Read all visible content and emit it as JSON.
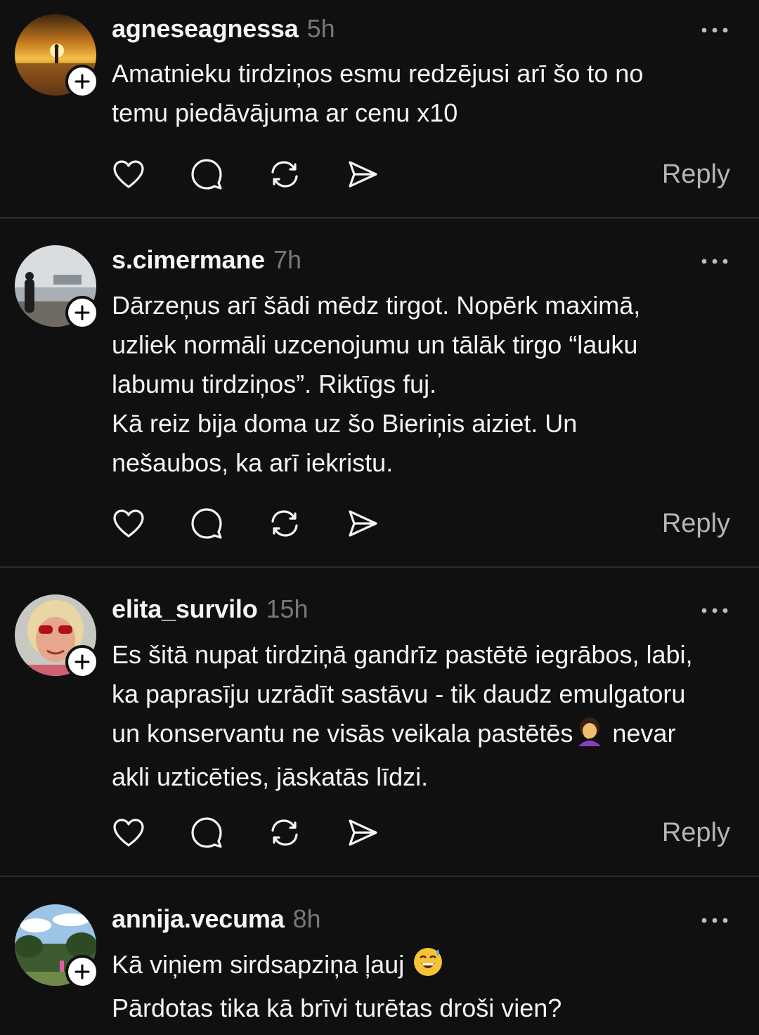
{
  "posts": [
    {
      "username": "agneseagnessa",
      "time": "5h",
      "lines": [
        "Amatnieku tirdziņos esmu redzējusi arī šo to no",
        "temu piedāvājuma ar cenu x10"
      ],
      "reply_label": "Reply"
    },
    {
      "username": "s.cimermane",
      "time": "7h",
      "lines": [
        "Dārzeņus arī šādi mēdz tirgot. Nopērk maximā,",
        "uzliek normāli uzcenojumu un tālāk tirgo “lauku",
        "labumu tirdziņos”. Riktīgs fuj.",
        "Kā reiz bija doma uz šo Bieriņis aiziet. Un",
        "nešaubos, ka arī iekristu."
      ],
      "reply_label": "Reply"
    },
    {
      "username": "elita_survilo",
      "time": "15h",
      "lines": [
        "Es šitā nupat tirdziņā gandrīz pastētē iegrābos, labi,",
        "ka paprasīju uzrādīt sastāvu - tik daudz emulgatoru",
        "un konservantu ne visās veikala pastētēs",
        "akli uzticēties, jāskatās līdzi."
      ],
      "line3_suffix": " nevar",
      "reply_label": "Reply"
    },
    {
      "username": "annija.vecuma",
      "time": "8h",
      "lines": [
        "Kā viņiem sirdsapziņa ļauj",
        "Pārdotas tika kā brīvi turētas droši vien?"
      ]
    }
  ],
  "icons": {
    "like": "heart-icon",
    "comment": "comment-bubble-icon",
    "repost": "repost-icon",
    "share": "send-icon",
    "more": "more-horizontal-icon",
    "follow": "plus-icon"
  },
  "colors": {
    "background": "#101010",
    "text": "#f3f5f7",
    "muted": "#777777",
    "divider": "#2b2b2b",
    "reply": "#b5b5b5"
  }
}
